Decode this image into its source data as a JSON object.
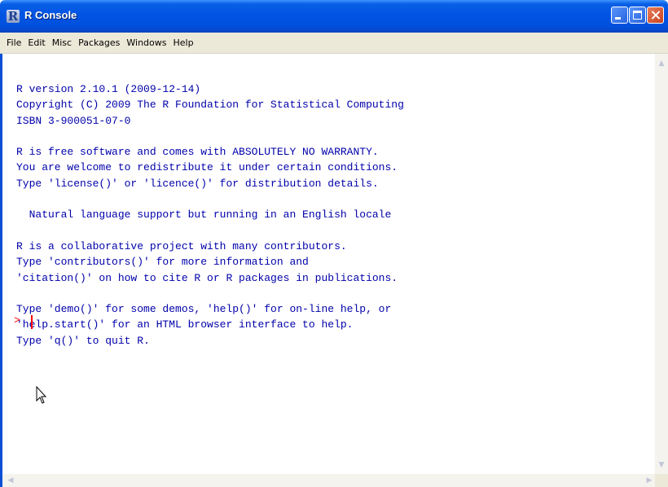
{
  "window": {
    "title": "R Console",
    "icon_letter": "R"
  },
  "menu": {
    "items": [
      {
        "label": "File"
      },
      {
        "label": "Edit"
      },
      {
        "label": "Misc"
      },
      {
        "label": "Packages"
      },
      {
        "label": "Windows"
      },
      {
        "label": "Help"
      }
    ]
  },
  "console": {
    "lines": [
      "R version 2.10.1 (2009-12-14)",
      "Copyright (C) 2009 The R Foundation for Statistical Computing",
      "ISBN 3-900051-07-0",
      "",
      "R is free software and comes with ABSOLUTELY NO WARRANTY.",
      "You are welcome to redistribute it under certain conditions.",
      "Type 'license()' or 'licence()' for distribution details.",
      "",
      "  Natural language support but running in an English locale",
      "",
      "R is a collaborative project with many contributors.",
      "Type 'contributors()' for more information and",
      "'citation()' on how to cite R or R packages in publications.",
      "",
      "Type 'demo()' for some demos, 'help()' for on-line help, or",
      "'help.start()' for an HTML browser interface to help.",
      "Type 'q()' to quit R."
    ],
    "prompt": ">",
    "text_color": "#0000aa",
    "prompt_color": "#ff0000"
  },
  "icons": {
    "minimize": "minimize-icon",
    "maximize": "maximize-icon",
    "close": "close-icon",
    "scroll_up": "chevron-up-icon",
    "scroll_down": "chevron-down-icon",
    "scroll_left": "chevron-left-icon",
    "scroll_right": "chevron-right-icon",
    "mouse": "mouse-pointer-icon"
  },
  "colors": {
    "titlebar": "#0054e3",
    "menubar": "#ece9d8",
    "close_button": "#c9401c"
  }
}
